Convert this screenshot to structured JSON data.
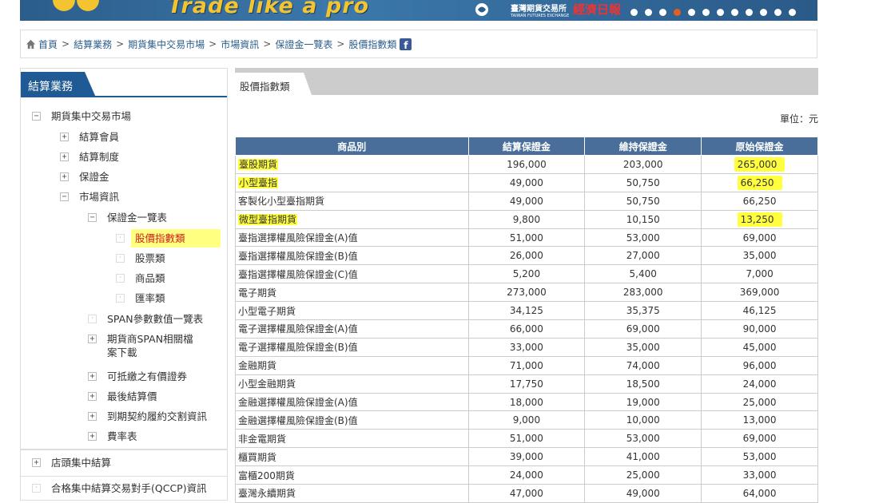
{
  "banner": {
    "slogan": "Trade like a pro",
    "logo_exchange": "臺灣期貨交易所",
    "logo_exchange_en": "TAIWAN FUTURES EXCHANGE",
    "logo_news": "經濟日報",
    "slide_count": 12,
    "active_slide": 3
  },
  "breadcrumb": {
    "items": [
      "首頁",
      "結算業務",
      "期貨集中交易市場",
      "市場資訊",
      "保證金一覽表",
      "股價指數類"
    ],
    "separator": ">",
    "facebook_label": "f"
  },
  "sidebar": {
    "title": "結算業務",
    "tree": [
      {
        "label": "期貨集中交易市場",
        "toggle": "−"
      },
      {
        "label": "結算會員",
        "toggle": "+"
      },
      {
        "label": "結算制度",
        "toggle": "+"
      },
      {
        "label": "保證金",
        "toggle": "+"
      },
      {
        "label": "市場資訊",
        "toggle": "−"
      },
      {
        "label": "保證金一覽表",
        "toggle": "−"
      },
      {
        "label": "股價指數類",
        "bullet": "·"
      },
      {
        "label": "股票類",
        "bullet": "·"
      },
      {
        "label": "商品類",
        "bullet": "·"
      },
      {
        "label": "匯率類",
        "bullet": "·"
      },
      {
        "label": "SPAN參數數值一覽表",
        "bullet": "·"
      },
      {
        "label": "期貨商SPAN相關檔案下載",
        "toggle": "+"
      },
      {
        "label": "可抵繳之有價證券",
        "toggle": "+"
      },
      {
        "label": "最後結算價",
        "toggle": "+"
      },
      {
        "label": "到期契約履約交割資訊",
        "toggle": "+"
      },
      {
        "label": "費率表",
        "toggle": "+"
      }
    ],
    "bottom_items": [
      {
        "label": "店頭集中結算",
        "toggle": "+"
      },
      {
        "label": "合格集中結算交易對手(QCCP)資訊",
        "bullet": "·"
      }
    ]
  },
  "main": {
    "tab_label": "股價指數類",
    "unit_label": "單位：元",
    "headers": [
      "商品別",
      "結算保證金",
      "維持保證金",
      "原始保證金"
    ],
    "rows": [
      {
        "name": "臺股期貨",
        "settle": "196,000",
        "maint": "203,000",
        "init": "265,000",
        "hl_name": true,
        "hl_init": true
      },
      {
        "name": "小型臺指",
        "settle": "49,000",
        "maint": "50,750",
        "init": "66,250",
        "hl_name": true,
        "hl_init": true
      },
      {
        "name": "客製化小型臺指期貨",
        "settle": "49,000",
        "maint": "50,750",
        "init": "66,250"
      },
      {
        "name": "微型臺指期貨",
        "settle": "9,800",
        "maint": "10,150",
        "init": "13,250",
        "hl_name": true,
        "hl_init": true
      },
      {
        "name": "臺指選擇權風險保證金(A)值",
        "settle": "51,000",
        "maint": "53,000",
        "init": "69,000"
      },
      {
        "name": "臺指選擇權風險保證金(B)值",
        "settle": "26,000",
        "maint": "27,000",
        "init": "35,000"
      },
      {
        "name": "臺指選擇權風險保證金(C)值",
        "settle": "5,200",
        "maint": "5,400",
        "init": "7,000"
      },
      {
        "name": "電子期貨",
        "settle": "273,000",
        "maint": "283,000",
        "init": "369,000"
      },
      {
        "name": "小型電子期貨",
        "settle": "34,125",
        "maint": "35,375",
        "init": "46,125"
      },
      {
        "name": "電子選擇權風險保證金(A)值",
        "settle": "66,000",
        "maint": "69,000",
        "init": "90,000"
      },
      {
        "name": "電子選擇權風險保證金(B)值",
        "settle": "33,000",
        "maint": "35,000",
        "init": "45,000"
      },
      {
        "name": "金融期貨",
        "settle": "71,000",
        "maint": "74,000",
        "init": "96,000"
      },
      {
        "name": "小型金融期貨",
        "settle": "17,750",
        "maint": "18,500",
        "init": "24,000"
      },
      {
        "name": "金融選擇權風險保證金(A)值",
        "settle": "18,000",
        "maint": "19,000",
        "init": "25,000"
      },
      {
        "name": "金融選擇權風險保證金(B)值",
        "settle": "9,000",
        "maint": "10,000",
        "init": "13,000"
      },
      {
        "name": "非金電期貨",
        "settle": "51,000",
        "maint": "53,000",
        "init": "69,000"
      },
      {
        "name": "櫃買期貨",
        "settle": "39,000",
        "maint": "41,000",
        "init": "53,000"
      },
      {
        "name": "富櫃200期貨",
        "settle": "24,000",
        "maint": "25,000",
        "init": "33,000"
      },
      {
        "name": "臺灣永續期貨",
        "settle": "47,000",
        "maint": "49,000",
        "init": "64,000"
      }
    ]
  },
  "colors": {
    "header_blue": "#4a6e9a",
    "side_tab": "#1f5a95",
    "highlight": "#ffff40",
    "active_red": "#d02020"
  }
}
